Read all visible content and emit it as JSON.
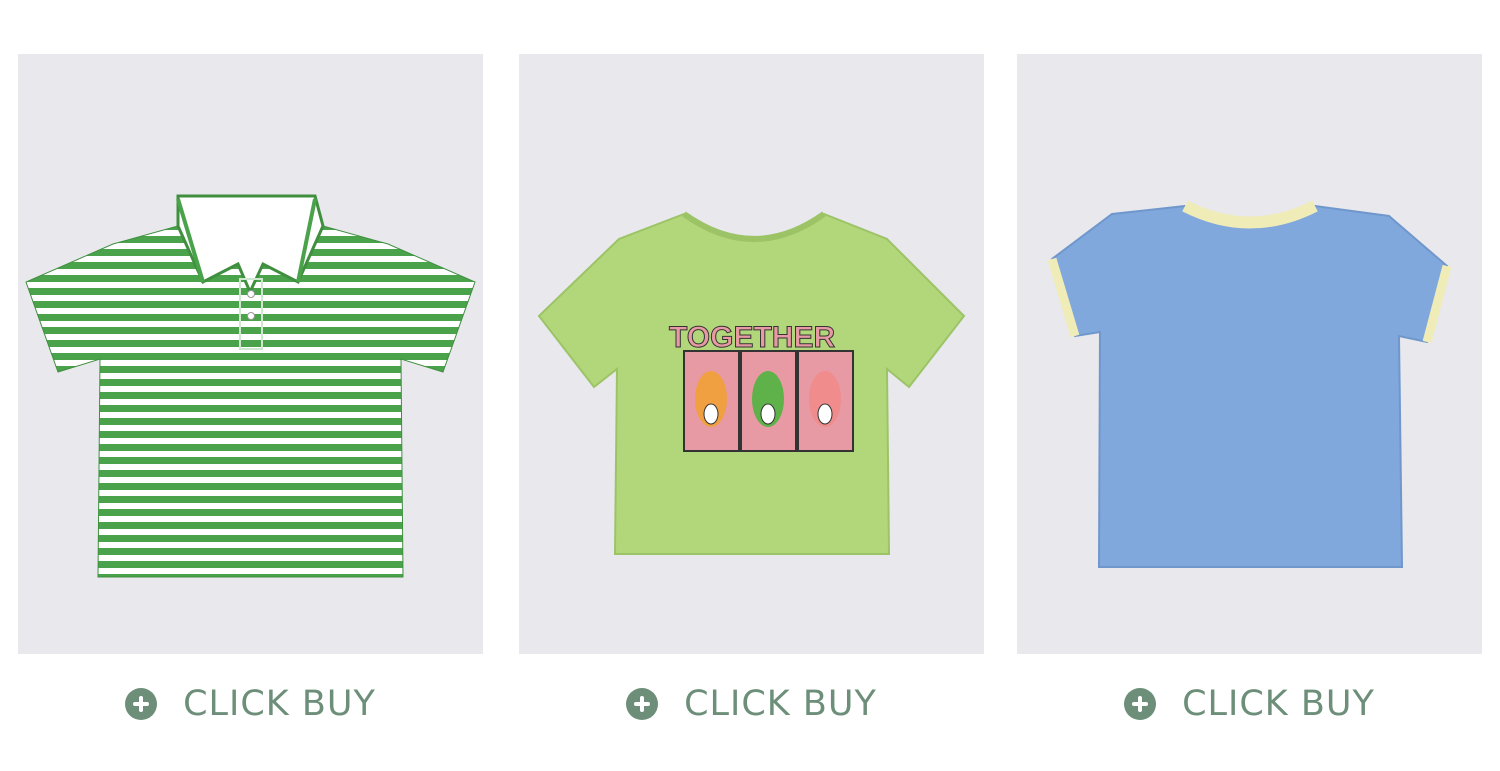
{
  "colors": {
    "accent": "#6d8f7a",
    "card_bg": "#e8e8ed",
    "page_bg": "#ffffff"
  },
  "products": [
    {
      "image_subject": "green and white striped polo shirt",
      "button": {
        "icon": "plus-circle-icon",
        "label": "CLICK BUY"
      }
    },
    {
      "image_subject": "light green t-shirt with graphic print",
      "graphic_text": "TOGETHER",
      "button": {
        "icon": "plus-circle-icon",
        "label": "CLICK BUY"
      }
    },
    {
      "image_subject": "blue ringer t-shirt with cream trim",
      "button": {
        "icon": "plus-circle-icon",
        "label": "CLICK BUY"
      }
    }
  ]
}
